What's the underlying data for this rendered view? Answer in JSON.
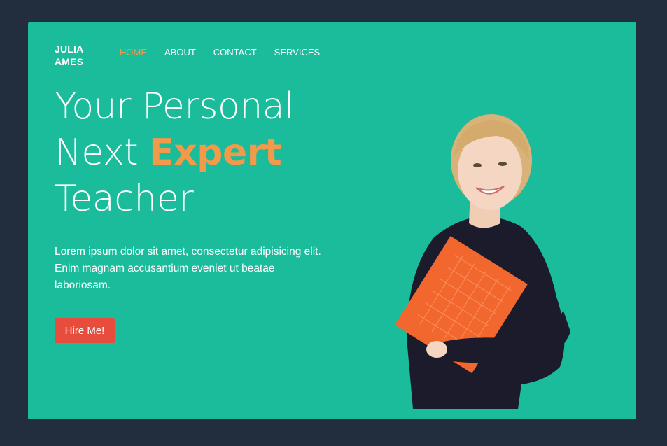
{
  "logo": {
    "line1": "JULIA",
    "line2": "AMES"
  },
  "nav": {
    "items": [
      {
        "label": "HOME",
        "active": true
      },
      {
        "label": "ABOUT",
        "active": false
      },
      {
        "label": "CONTACT",
        "active": false
      },
      {
        "label": "SERVICES",
        "active": false
      }
    ]
  },
  "hero": {
    "line1": "Your Personal",
    "line2_pre": "Next ",
    "line2_accent": "Expert",
    "line3": "Teacher",
    "lead": "Lorem ipsum dolor sit amet, consectetur adipisicing elit. Enim magnam accusantium eveniet ut beatae laboriosam.",
    "cta_label": "Hire Me!"
  },
  "colors": {
    "page_bg": "#222d3d",
    "card_bg": "#1bbc9b",
    "accent": "#f2994a",
    "cta": "#e74c3c"
  },
  "image": {
    "semantic": "portrait of smiling woman holding orange folder"
  }
}
